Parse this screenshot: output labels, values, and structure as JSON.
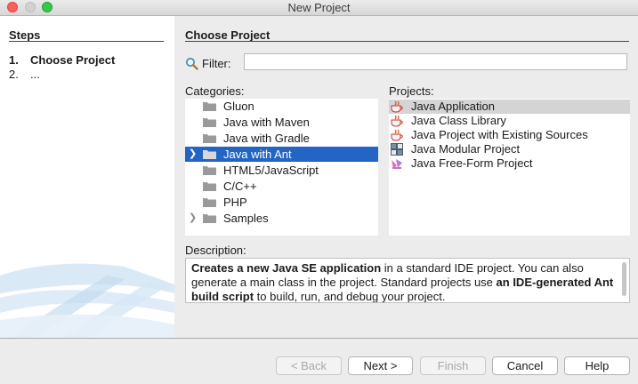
{
  "window": {
    "title": "New Project"
  },
  "steps": {
    "heading": "Steps",
    "items": [
      {
        "num": "1.",
        "label": "Choose Project"
      },
      {
        "num": "2.",
        "label": "..."
      }
    ]
  },
  "main": {
    "heading": "Choose Project",
    "filter": {
      "label": "Filter:",
      "value": "",
      "placeholder": ""
    },
    "categories_label": "Categories:",
    "projects_label": "Projects:",
    "categories": [
      {
        "label": "Gluon",
        "expandable": false,
        "selected": false
      },
      {
        "label": "Java with Maven",
        "expandable": false,
        "selected": false
      },
      {
        "label": "Java with Gradle",
        "expandable": false,
        "selected": false
      },
      {
        "label": "Java with Ant",
        "expandable": true,
        "selected": true
      },
      {
        "label": "HTML5/JavaScript",
        "expandable": false,
        "selected": false
      },
      {
        "label": "C/C++",
        "expandable": false,
        "selected": false
      },
      {
        "label": "PHP",
        "expandable": false,
        "selected": false
      },
      {
        "label": "Samples",
        "expandable": true,
        "selected": false
      }
    ],
    "projects": [
      {
        "label": "Java Application",
        "icon": "java-cup-icon",
        "selected": true
      },
      {
        "label": "Java Class Library",
        "icon": "java-cup-icon",
        "selected": false
      },
      {
        "label": "Java Project with Existing Sources",
        "icon": "java-cup-icon",
        "selected": false
      },
      {
        "label": "Java Modular Project",
        "icon": "modules-icon",
        "selected": false
      },
      {
        "label": "Java Free-Form Project",
        "icon": "freeform-icon",
        "selected": false
      }
    ],
    "description_label": "Description:",
    "description": {
      "p1_bold": "Creates a new Java SE application",
      "p2": " in a standard IDE project. You can also generate a main class in the project. Standard projects use ",
      "p3_bold": "an IDE-generated Ant build script",
      "p4": " to build, run, and debug your project."
    }
  },
  "buttons": {
    "back": "< Back",
    "next": "Next >",
    "finish": "Finish",
    "cancel": "Cancel",
    "help": "Help"
  },
  "colors": {
    "selection": "#2265c4",
    "close": "#fc5f57",
    "zoom": "#35c84a"
  }
}
